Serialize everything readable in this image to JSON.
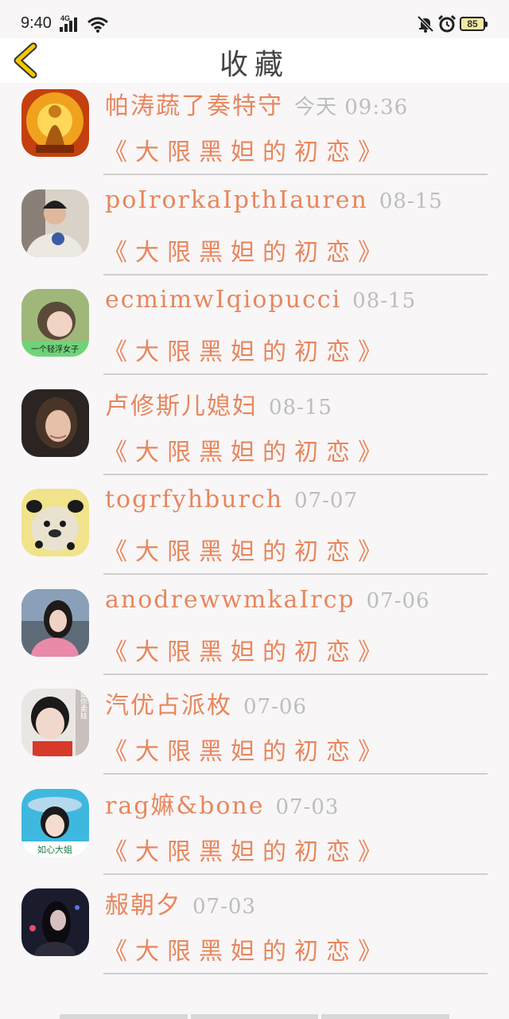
{
  "status_bar": {
    "time": "9:40",
    "network": "4G",
    "battery": "85"
  },
  "header": {
    "title": "收藏",
    "back_icon": "chevron-left-icon",
    "accent_color": "#f5c800"
  },
  "favorites": [
    {
      "name": "帕涛蔬了奏特守",
      "time": "今天 09:36",
      "post_title": "《大限黑妲的初恋》",
      "avatar": "golden-statue"
    },
    {
      "name": "poIrorkaIpthIauren",
      "time": "08-15",
      "post_title": "《大限黑妲的初恋》",
      "avatar": "man-beanie"
    },
    {
      "name": "ecmimwIqiopucci",
      "time": "08-15",
      "post_title": "《大限黑妲的初恋》",
      "avatar": "girl-caption"
    },
    {
      "name": "卢修斯儿媳妇",
      "time": "08-15",
      "post_title": "《大限黑妲的初恋》",
      "avatar": "woman-dark"
    },
    {
      "name": "togrfyhburch",
      "time": "07-07",
      "post_title": "《大限黑妲的初恋》",
      "avatar": "dog-yellow"
    },
    {
      "name": "anodrewwmkaIrcp",
      "time": "07-06",
      "post_title": "《大限黑妲的初恋》",
      "avatar": "girl-pink"
    },
    {
      "name": "汽优占派枚",
      "time": "07-06",
      "post_title": "《大限黑妲的初恋》",
      "avatar": "boy-caption"
    },
    {
      "name": "rag嫲&bone",
      "time": "07-03",
      "post_title": "《大限黑妲的初恋》",
      "avatar": "girl-hat"
    },
    {
      "name": "赧朝夕",
      "time": "07-03",
      "post_title": "《大限黑妲的初恋》",
      "avatar": "girl-night"
    }
  ],
  "avatar_captions": {
    "girl_caption": "一个轻浮女子",
    "boy_caption": "小姐你卖娃",
    "hat_caption": "如心大姐"
  },
  "colors": {
    "name": "#e8865d",
    "time": "#bdbdbd",
    "divider": "#cfcfcf",
    "background": "#f8f6f7"
  }
}
